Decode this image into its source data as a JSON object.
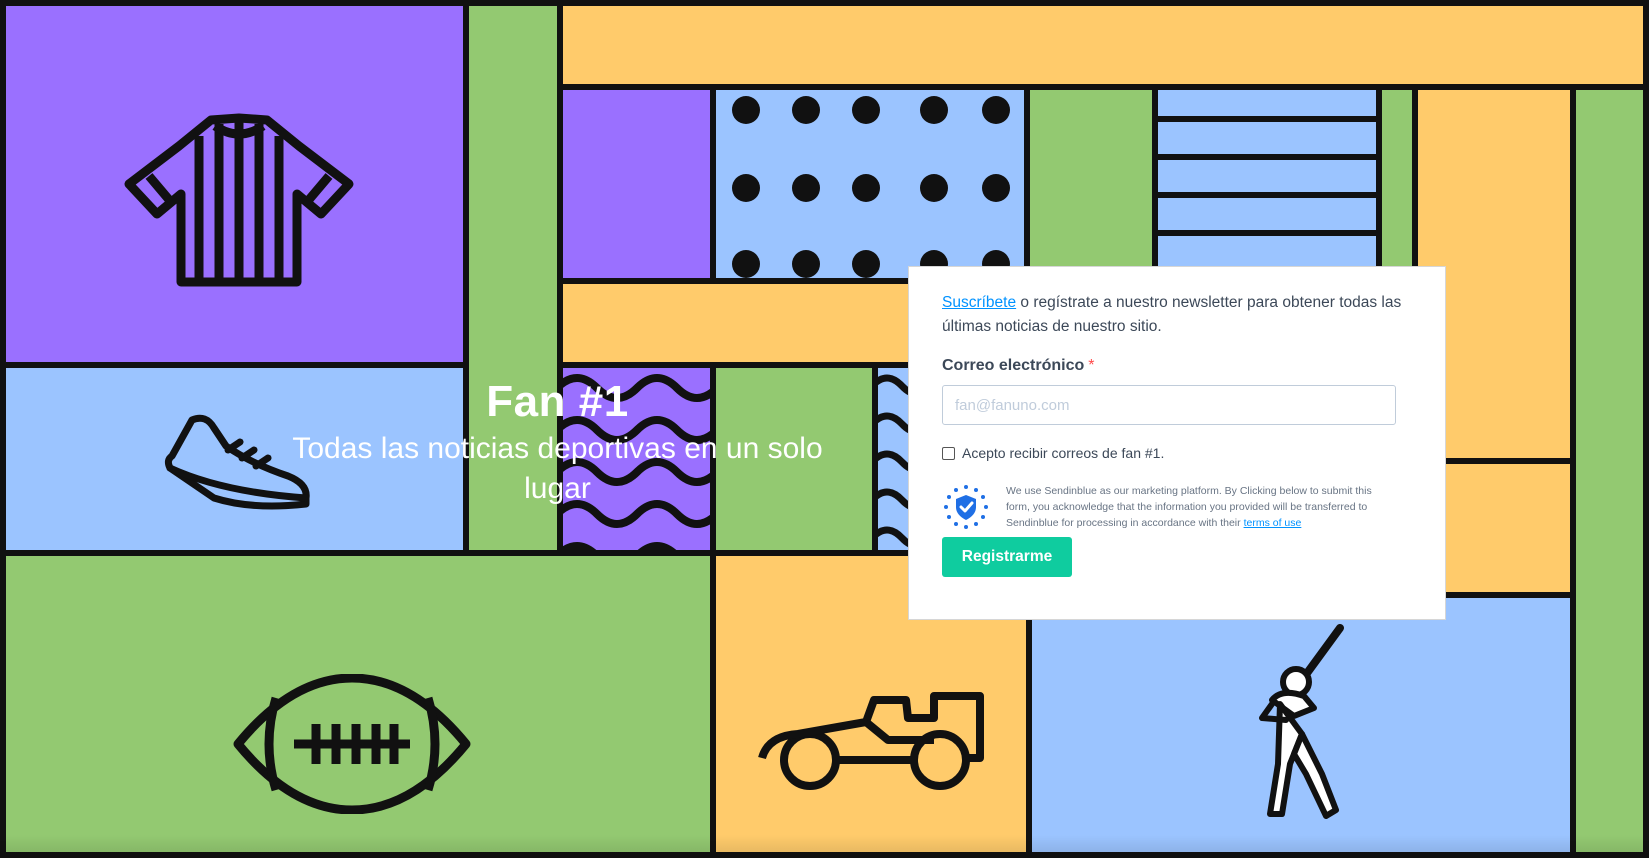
{
  "hero": {
    "title": "Fan #1",
    "subtitle": "Todas las noticias deportivas en un solo lugar"
  },
  "form": {
    "intro_link": "Suscríbete",
    "intro_text": " o regístrate a nuestro newsletter para obtener todas las últimas noticias de nuestro sitio.",
    "email_label": "Correo electrónico",
    "required_mark": "*",
    "email_placeholder": "fan@fanuno.com",
    "email_value": "",
    "opt_in_label": "Acepto recibir correos de fan #1.",
    "opt_in_checked": false,
    "gdpr_text": "We use Sendinblue as our marketing platform. By Clicking below to submit this form, you acknowledge that the information you provided will be transferred to Sendinblue for processing in accordance with their ",
    "gdpr_link": "terms of use",
    "submit_label": "Registrarme"
  },
  "icons": [
    "referee-shirt-icon",
    "sneaker-icon",
    "football-icon",
    "race-car-icon",
    "baseball-batter-icon",
    "gdpr-shield-icon"
  ],
  "colors": {
    "purple": "#9a70ff",
    "green": "#93c971",
    "yellow": "#ffcb6b",
    "blue": "#9bc4ff",
    "button": "#0fcc9f",
    "link": "#0092ff"
  }
}
